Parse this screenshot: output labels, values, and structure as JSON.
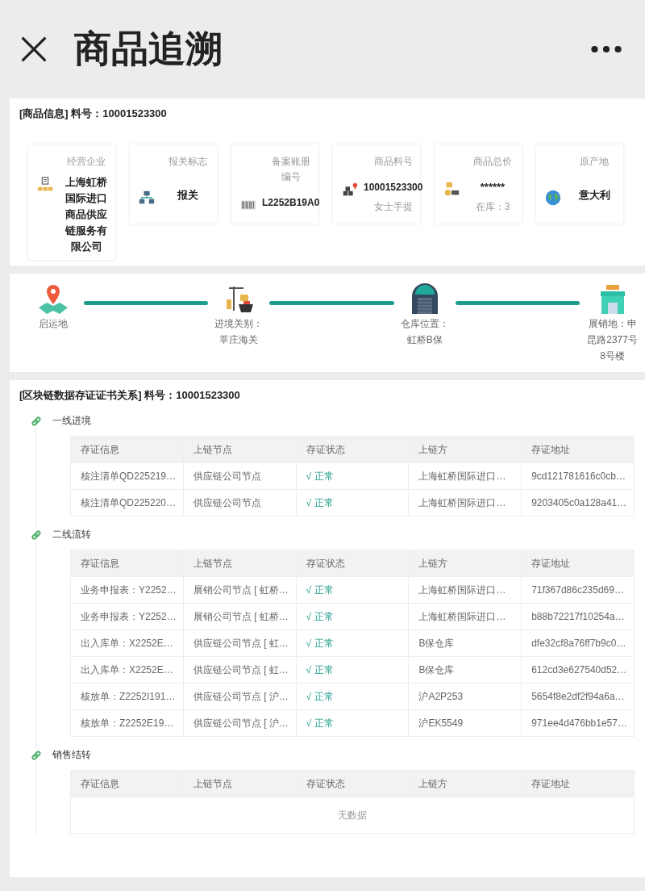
{
  "header": {
    "title": "商品追溯"
  },
  "product_info": {
    "heading": "[商品信息] 料号：10001523300",
    "cards": [
      {
        "label": "经营企业",
        "value": "上海虹桥国际进口商品供应链服务有限公司"
      },
      {
        "label": "报关标志",
        "value": "报关"
      },
      {
        "label": "备案账册编号",
        "value": "L2252B19A0"
      },
      {
        "label": "商品料号",
        "value": "10001523300",
        "sub": "女士手提"
      },
      {
        "label": "商品总价",
        "value": "******",
        "sub": "在库：3"
      },
      {
        "label": "原产地",
        "value": "意大利"
      }
    ]
  },
  "route": {
    "stops": [
      {
        "label": "启运地"
      },
      {
        "label": "进境关别：莘庄海关"
      },
      {
        "label": "仓库位置：虹桥B保"
      },
      {
        "label": "展销地：申昆路2377号8号楼"
      }
    ]
  },
  "blockchain": {
    "heading": "[区块链数据存证证书关系] 料号：10001523300",
    "groups": [
      {
        "title": "一线进境",
        "columns": [
          "存证信息",
          "上链节点",
          "存证状态",
          "上链方",
          "存证地址"
        ],
        "rows": [
          [
            "核注清单QD225219…",
            "供应链公司节点",
            "√ 正常",
            "上海虹桥国际进口…",
            "9cd121781616c0cb…"
          ],
          [
            "核注清单QD225220…",
            "供应链公司节点",
            "√ 正常",
            "上海虹桥国际进口…",
            "9203405c0a128a41…"
          ]
        ]
      },
      {
        "title": "二线流转",
        "columns": [
          "存证信息",
          "上链节点",
          "存证状态",
          "上链方",
          "存证地址"
        ],
        "rows": [
          [
            "业务申报表：Y2252…",
            "展销公司节点 [ 虹桥…",
            "√ 正常",
            "上海虹桥国际进口…",
            "71f367d86c235d69…"
          ],
          [
            "业务申报表：Y2252…",
            "展销公司节点 [ 虹桥…",
            "√ 正常",
            "上海虹桥国际进口…",
            "b88b72217f10254a…"
          ],
          [
            "出入库单：X2252E…",
            "供应链公司节点 [ 虹…",
            "√ 正常",
            "B保仓库",
            "dfe32cf8a76ff7b9c0…"
          ],
          [
            "出入库单：X2252E…",
            "供应链公司节点 [ 虹…",
            "√ 正常",
            "B保仓库",
            "612cd3e627540d52…"
          ],
          [
            "核放单：Z2252I191…",
            "供应链公司节点 [ 沪…",
            "√ 正常",
            "沪A2P253",
            "5654f8e2df2f94a6a…"
          ],
          [
            "核放单：Z2252E19…",
            "供应链公司节点 [ 沪…",
            "√ 正常",
            "沪EK5549",
            "971ee4d476bb1e57…"
          ]
        ]
      },
      {
        "title": "销售结转",
        "columns": [
          "存证信息",
          "上链节点",
          "存证状态",
          "上链方",
          "存证地址"
        ],
        "empty_text": "无数据"
      }
    ]
  }
}
